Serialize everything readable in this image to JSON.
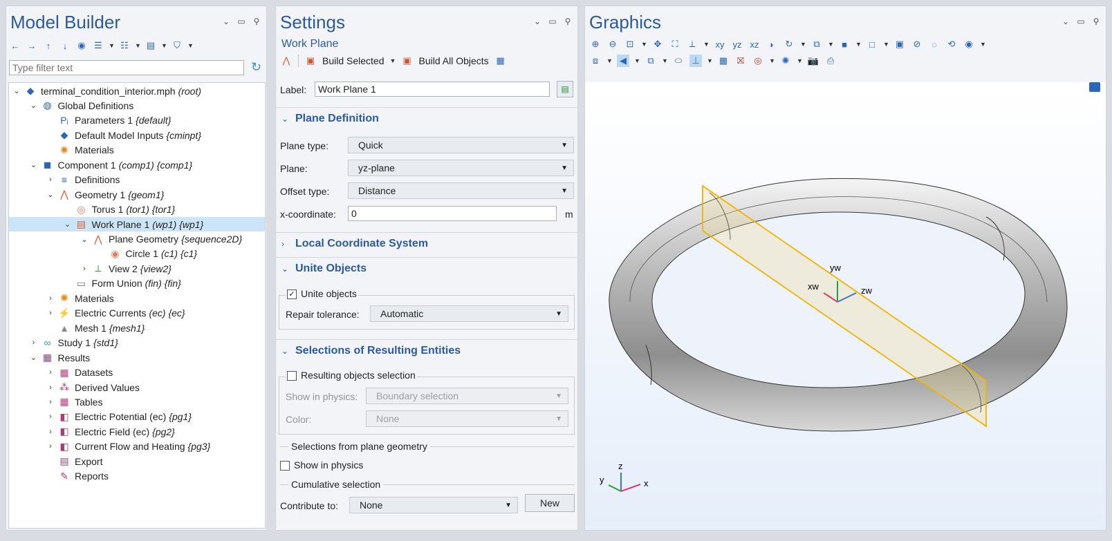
{
  "model_builder": {
    "title": "Model Builder",
    "filter_placeholder": "Type filter text",
    "tree": [
      {
        "level": 0,
        "arrow": "v",
        "icon": "model-root-icon",
        "label": "terminal_condition_interior.mph",
        "tag": "(root)"
      },
      {
        "level": 1,
        "arrow": "v",
        "icon": "globe-icon",
        "label": "Global Definitions",
        "tag": ""
      },
      {
        "level": 2,
        "arrow": "",
        "icon": "parameters-icon",
        "label": "Parameters 1",
        "tag": "{default}"
      },
      {
        "level": 2,
        "arrow": "",
        "icon": "model-inputs-icon",
        "label": "Default Model Inputs",
        "tag": "{cminpt}"
      },
      {
        "level": 2,
        "arrow": "",
        "icon": "materials-icon",
        "label": "Materials",
        "tag": ""
      },
      {
        "level": 1,
        "arrow": "v",
        "icon": "component-icon",
        "label": "Component 1",
        "tag": "(comp1) {comp1}"
      },
      {
        "level": 2,
        "arrow": ">",
        "icon": "definitions-icon",
        "label": "Definitions",
        "tag": ""
      },
      {
        "level": 2,
        "arrow": "v",
        "icon": "geometry-icon",
        "label": "Geometry 1",
        "tag": "{geom1}"
      },
      {
        "level": 3,
        "arrow": "",
        "icon": "torus-icon",
        "label": "Torus 1",
        "tag": "(tor1) {tor1}"
      },
      {
        "level": 3,
        "arrow": "v",
        "icon": "work-plane-icon",
        "label": "Work Plane 1",
        "tag": "(wp1) {wp1}",
        "selected": true
      },
      {
        "level": 4,
        "arrow": "v",
        "icon": "plane-geometry-icon",
        "label": "Plane Geometry",
        "tag": "{sequence2D}"
      },
      {
        "level": 5,
        "arrow": "",
        "icon": "circle-icon",
        "label": "Circle 1",
        "tag": "(c1) {c1}"
      },
      {
        "level": 4,
        "arrow": ">",
        "icon": "view-icon",
        "label": "View 2",
        "tag": "{view2}"
      },
      {
        "level": 3,
        "arrow": "",
        "icon": "form-union-icon",
        "label": "Form Union",
        "tag": "(fin) {fin}"
      },
      {
        "level": 2,
        "arrow": ">",
        "icon": "materials-icon",
        "label": "Materials",
        "tag": ""
      },
      {
        "level": 2,
        "arrow": ">",
        "icon": "electric-currents-icon",
        "label": "Electric Currents",
        "tag": "(ec) {ec}"
      },
      {
        "level": 2,
        "arrow": "",
        "icon": "mesh-icon",
        "label": "Mesh 1",
        "tag": "{mesh1}"
      },
      {
        "level": 1,
        "arrow": ">",
        "icon": "study-icon",
        "label": "Study 1",
        "tag": "{std1}"
      },
      {
        "level": 1,
        "arrow": "v",
        "icon": "results-icon",
        "label": "Results",
        "tag": ""
      },
      {
        "level": 2,
        "arrow": ">",
        "icon": "datasets-icon",
        "label": "Datasets",
        "tag": ""
      },
      {
        "level": 2,
        "arrow": ">",
        "icon": "derived-values-icon",
        "label": "Derived Values",
        "tag": ""
      },
      {
        "level": 2,
        "arrow": ">",
        "icon": "tables-icon",
        "label": "Tables",
        "tag": ""
      },
      {
        "level": 2,
        "arrow": ">",
        "icon": "plot-group-icon",
        "label": "Electric Potential (ec)",
        "tag": "{pg1}"
      },
      {
        "level": 2,
        "arrow": ">",
        "icon": "plot-group-icon",
        "label": "Electric Field (ec)",
        "tag": "{pg2}"
      },
      {
        "level": 2,
        "arrow": ">",
        "icon": "plot-group-icon",
        "label": "Current Flow and Heating",
        "tag": "{pg3}"
      },
      {
        "level": 2,
        "arrow": "",
        "icon": "export-icon",
        "label": "Export",
        "tag": ""
      },
      {
        "level": 2,
        "arrow": "",
        "icon": "reports-icon",
        "label": "Reports",
        "tag": ""
      }
    ]
  },
  "settings": {
    "title": "Settings",
    "subtitle": "Work Plane",
    "build_selected": "Build Selected",
    "build_all": "Build All Objects",
    "label_caption": "Label:",
    "label_value": "Work Plane 1",
    "plane_definition": {
      "header": "Plane Definition",
      "plane_type_label": "Plane type:",
      "plane_type": "Quick",
      "plane_label": "Plane:",
      "plane": "yz-plane",
      "offset_type_label": "Offset type:",
      "offset_type": "Distance",
      "x_coord_label": "x-coordinate:",
      "x_coord": "0",
      "x_unit": "m"
    },
    "local_coord_header": "Local Coordinate System",
    "unite": {
      "header": "Unite Objects",
      "checkbox": "Unite objects",
      "repair_label": "Repair tolerance:",
      "repair": "Automatic"
    },
    "selections": {
      "header": "Selections of Resulting Entities",
      "resulting_checkbox": "Resulting objects selection",
      "show_in_physics_label": "Show in physics:",
      "show_in_physics": "Boundary selection",
      "color_label": "Color:",
      "color": "None",
      "from_plane": "Selections from plane geometry",
      "show_in_physics_checkbox": "Show in physics",
      "cumulative": "Cumulative selection",
      "contribute_label": "Contribute to:",
      "contribute": "None",
      "new_button": "New"
    }
  },
  "graphics": {
    "title": "Graphics",
    "work_plane_axes": {
      "x": "xw",
      "y": "yw",
      "z": "zw"
    },
    "global_axes": {
      "x": "x",
      "y": "y",
      "z": "z"
    }
  },
  "colors": {
    "accent": "#2c5aa0",
    "selection": "#cce4f7",
    "plane": "#f0b400"
  }
}
